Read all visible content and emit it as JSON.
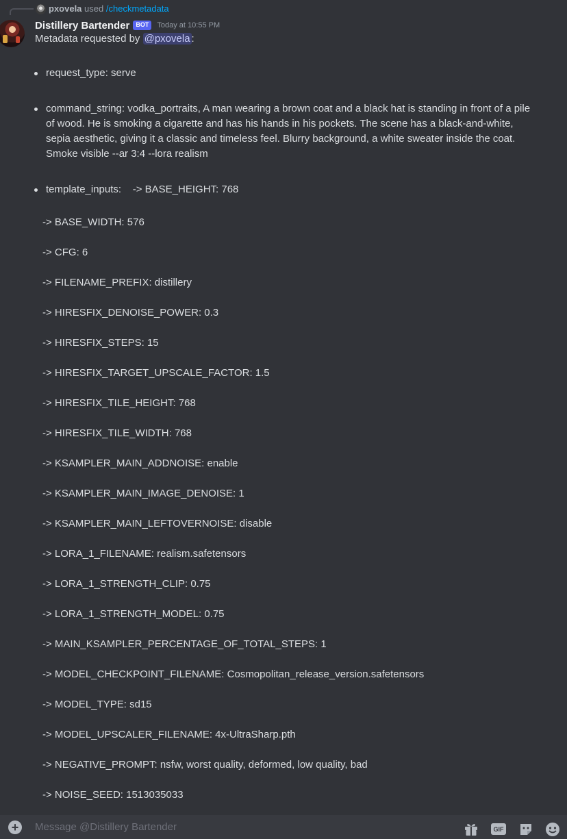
{
  "reply": {
    "username": "pxovela",
    "used_text": "used",
    "command": "/checkmetadata"
  },
  "message": {
    "author": "Distillery Bartender",
    "bot_badge": "BOT",
    "timestamp": "Today at 10:55 PM",
    "intro_prefix": "Metadata requested by",
    "mention": "@pxovela",
    "intro_suffix": ":",
    "bullets": [
      "request_type: serve",
      "command_string: vodka_portraits, A man wearing a brown coat and a black hat is standing in front of a pile of wood. He is smoking a cigarette and has his hands in his pockets. The scene has a black-and-white, sepia aesthetic, giving it a classic and timeless feel. Blurry background, a white sweater inside the coat. Smoke visible --ar 3:4 --lora realism",
      "template_inputs:    -> BASE_HEIGHT: 768"
    ],
    "params": [
      "-> BASE_WIDTH: 576",
      "-> CFG: 6",
      "-> FILENAME_PREFIX: distillery",
      "-> HIRESFIX_DENOISE_POWER: 0.3",
      "-> HIRESFIX_STEPS: 15",
      "-> HIRESFIX_TARGET_UPSCALE_FACTOR: 1.5",
      "-> HIRESFIX_TILE_HEIGHT: 768",
      "-> HIRESFIX_TILE_WIDTH: 768",
      "-> KSAMPLER_MAIN_ADDNOISE: enable",
      "-> KSAMPLER_MAIN_IMAGE_DENOISE: 1",
      "-> KSAMPLER_MAIN_LEFTOVERNOISE: disable",
      "-> LORA_1_FILENAME: realism.safetensors",
      "-> LORA_1_STRENGTH_CLIP: 0.75",
      "-> LORA_1_STRENGTH_MODEL: 0.75",
      "-> MAIN_KSAMPLER_PERCENTAGE_OF_TOTAL_STEPS: 1",
      "-> MODEL_CHECKPOINT_FILENAME: Cosmopolitan_release_version.safetensors",
      "-> MODEL_TYPE: sd15",
      "-> MODEL_UPSCALER_FILENAME: 4x-UltraSharp.pth",
      "-> NEGATIVE_PROMPT: nsfw, worst quality, deformed, low quality, bad",
      "-> NOISE_SEED: 1513035033"
    ]
  },
  "composer": {
    "placeholder": "Message @Distillery Bartender",
    "gif_label": "GIF",
    "icons": [
      "add-icon",
      "gift-icon",
      "gif-icon",
      "sticker-icon",
      "emoji-icon"
    ]
  },
  "colors": {
    "background": "#313338",
    "composer_bg": "#383a40",
    "bot_badge": "#5865f2",
    "link": "#00a8fc",
    "mention_bg": "#3c4270"
  }
}
